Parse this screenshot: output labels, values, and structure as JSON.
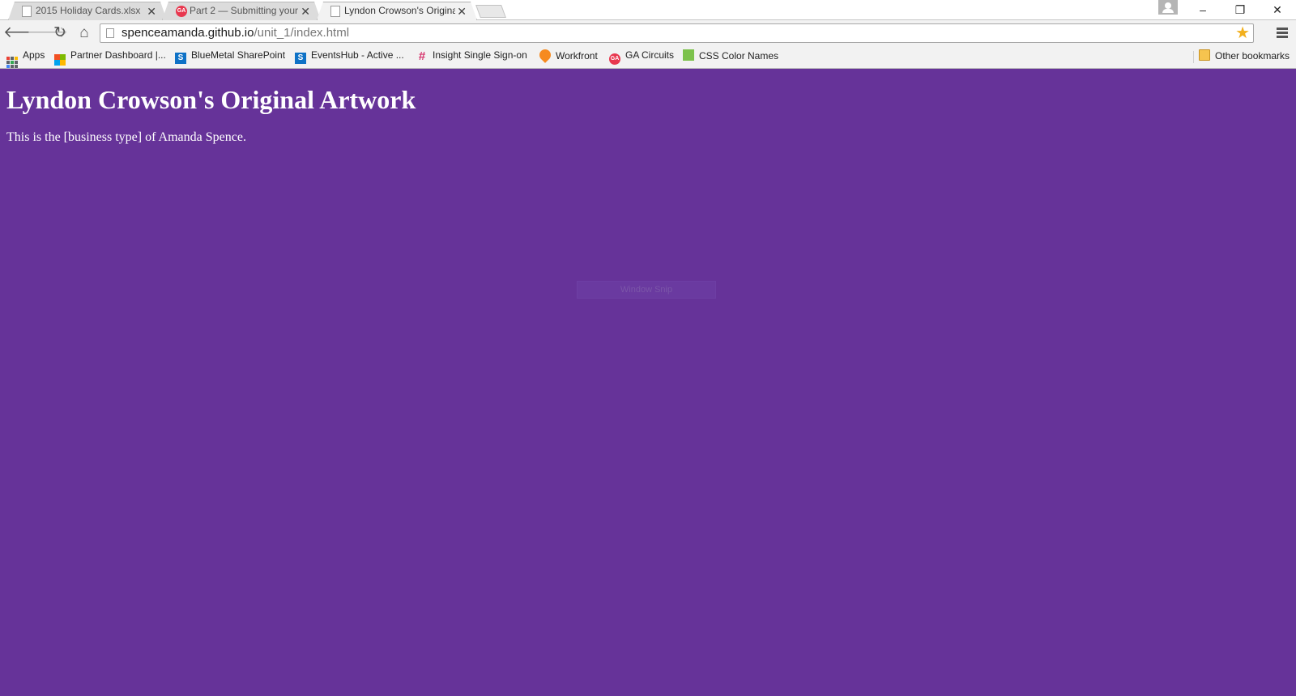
{
  "browser": {
    "tabs": [
      {
        "title": "2015 Holiday Cards.xlsx",
        "icon": "document-icon",
        "active": false
      },
      {
        "title": "Part 2 — Submitting your",
        "icon": "ga-logo-icon",
        "icon_text": "GA",
        "active": false
      },
      {
        "title": "Lyndon Crowson's Original",
        "icon": "document-icon",
        "active": true
      }
    ],
    "window_controls": {
      "minimize": "–",
      "restore": "❐",
      "close": "✕"
    },
    "toolbar": {
      "back": "🡐",
      "forward": "🡒",
      "reload": "↻",
      "home": "⌂",
      "url_host": "spenceamanda.github.io",
      "url_path": "/unit_1/index.html",
      "star": "★"
    },
    "bookmarks": [
      {
        "label": "Apps",
        "icon": "apps-grid-icon"
      },
      {
        "label": "Partner Dashboard |...",
        "icon": "microsoft-logo-icon"
      },
      {
        "label": "BlueMetal SharePoint",
        "icon": "sharepoint-icon",
        "icon_text": "S"
      },
      {
        "label": "EventsHub - Active ...",
        "icon": "sharepoint-icon",
        "icon_text": "S"
      },
      {
        "label": "Insight Single Sign-on",
        "icon": "hashtag-icon",
        "icon_text": "#"
      },
      {
        "label": "Workfront",
        "icon": "workfront-icon"
      },
      {
        "label": "GA Circuits",
        "icon": "ga-logo-icon",
        "icon_text": "GA"
      },
      {
        "label": "CSS Color Names",
        "icon": "css-color-icon"
      }
    ],
    "other_bookmarks": "Other bookmarks"
  },
  "page": {
    "title": "Lyndon Crowson's Original Artwork",
    "text": "This is the [business type] of Amanda Spence.",
    "background_color": "#663399",
    "overlay_label": "Window Snip"
  },
  "colors": {
    "page_background": "#663399",
    "page_text": "#ffffff",
    "bookmark_star": "#f2b01e"
  }
}
